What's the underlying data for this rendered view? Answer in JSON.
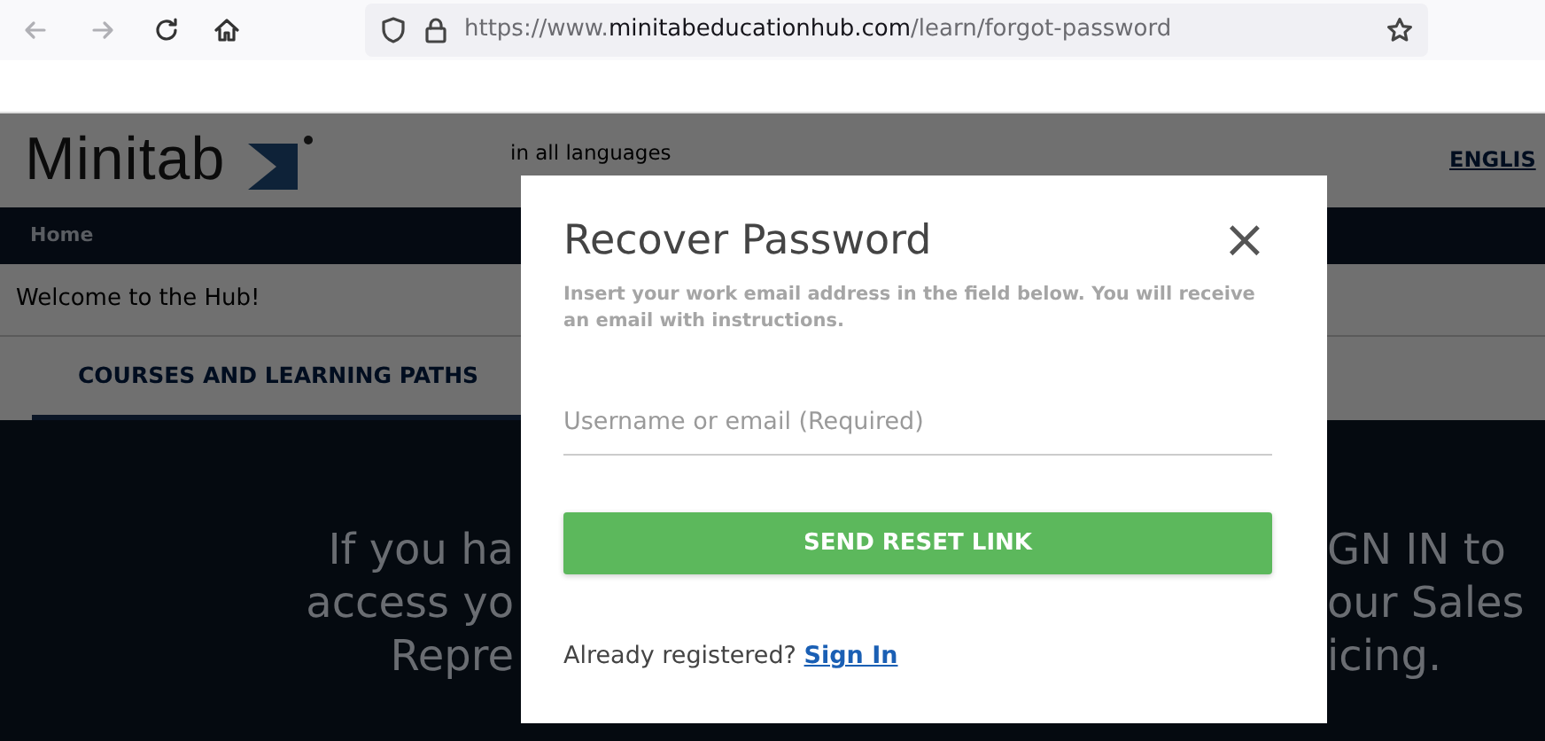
{
  "browser": {
    "url_prefix": "https://www.",
    "url_domain": "minitabeducationhub.com",
    "url_path": "/learn/forgot-password"
  },
  "header": {
    "logo": "Minitab",
    "tagline": "in all languages",
    "language": "ENGLIS"
  },
  "nav": {
    "items": [
      "Home"
    ]
  },
  "welcome": "Welcome to the Hub!",
  "tabs": [
    {
      "label": "COURSES AND LEARNING PATHS",
      "selected": true
    }
  ],
  "hero_lines": [
    {
      "left": "If you ha",
      "right": "GN IN to"
    },
    {
      "left": "access yo",
      "right": "our Sales"
    },
    {
      "left": "Repre",
      "right": "icing."
    }
  ],
  "modal": {
    "title": "Recover Password",
    "close": "×",
    "description": "Insert your work email address in the field below. You will receive an email with instructions.",
    "field": {
      "placeholder": "Username or email (Required)"
    },
    "button": "SEND RESET LINK",
    "footer_text": "Already registered?",
    "footer_link": "Sign In"
  }
}
